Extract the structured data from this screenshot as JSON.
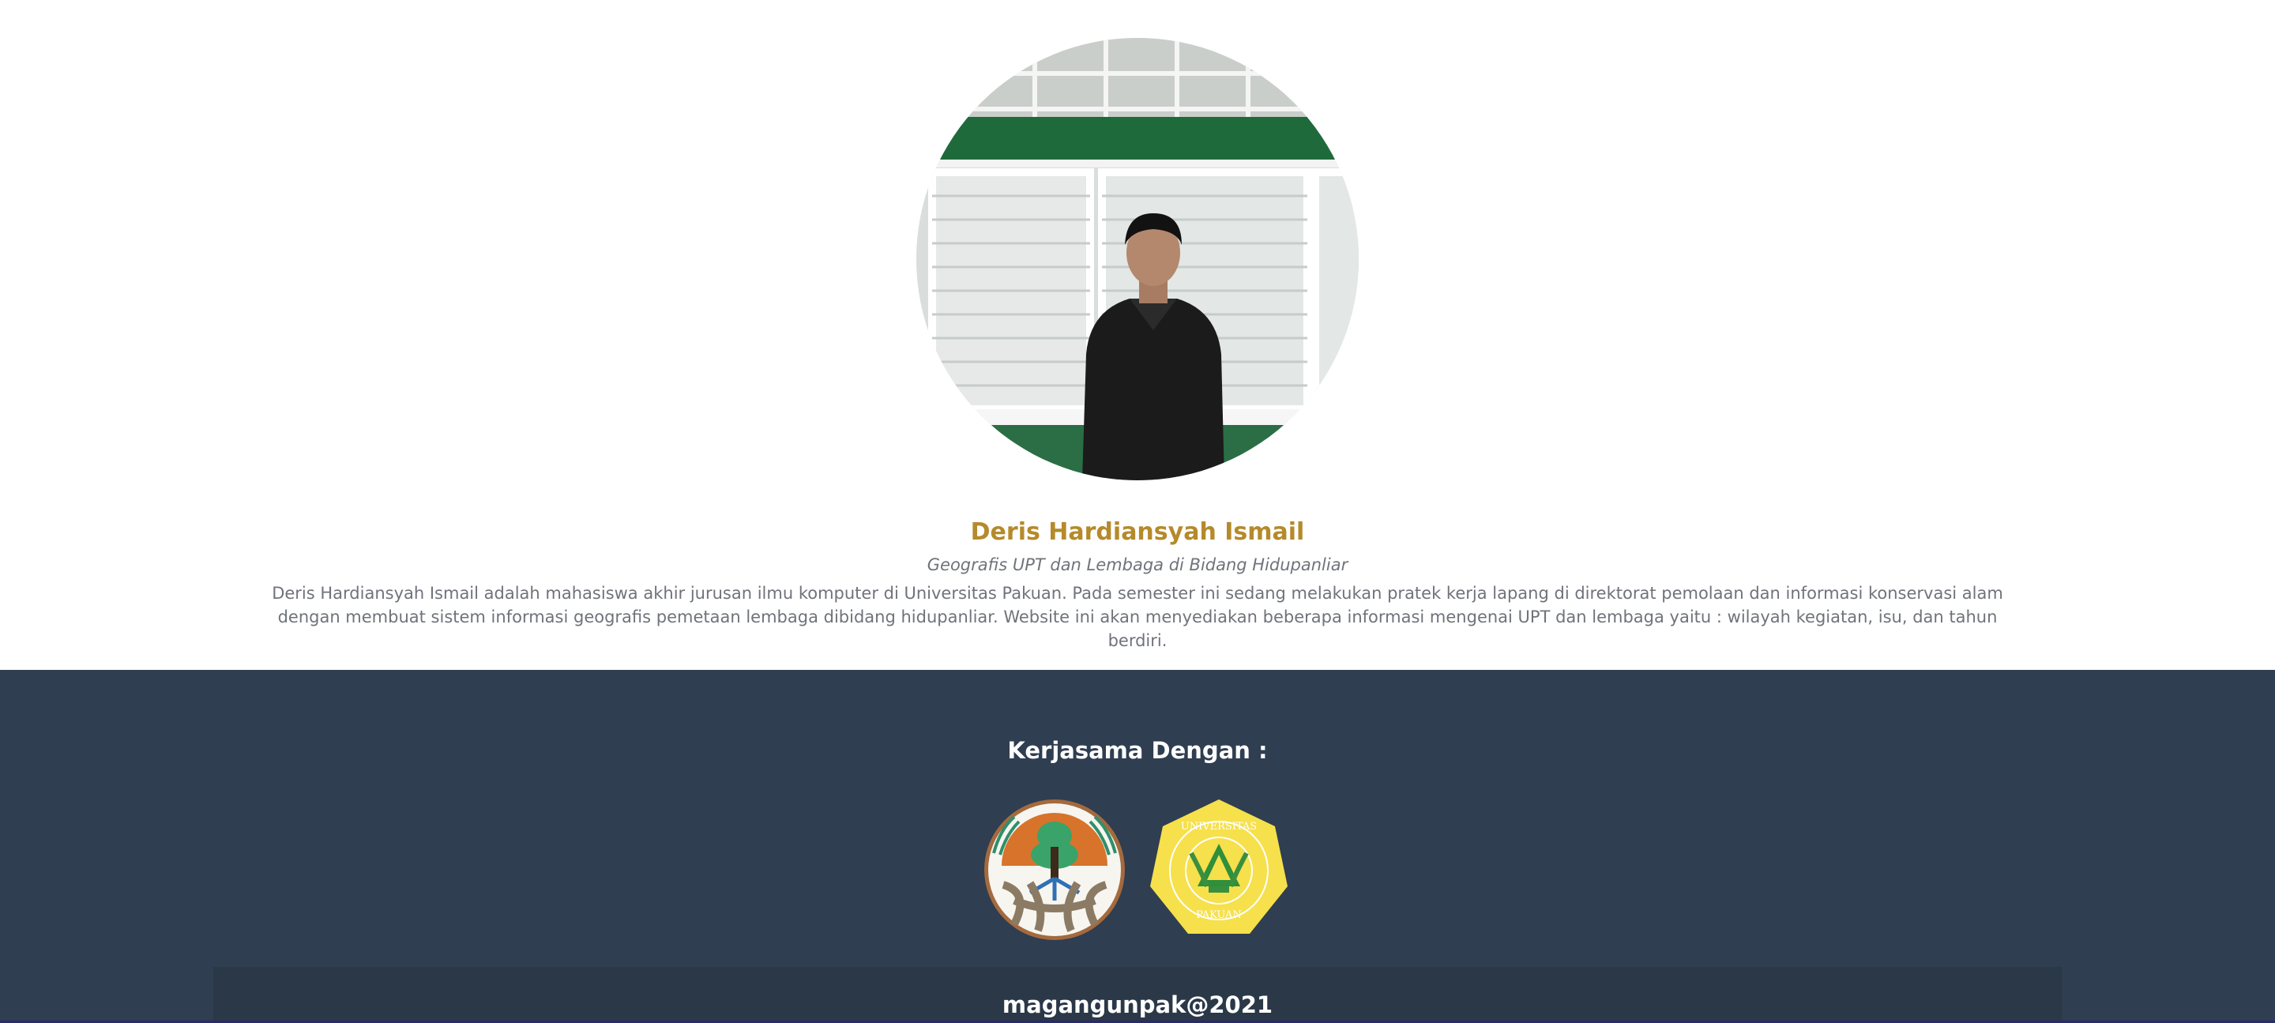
{
  "profile": {
    "photo_alt": "Deris Hardiansyah Ismail",
    "name": "Deris Hardiansyah Ismail",
    "role": "Geografis UPT dan Lembaga di Bidang Hidupanliar",
    "bio": "Deris Hardiansyah Ismail adalah mahasiswa akhir jurusan ilmu komputer di Universitas Pakuan. Pada semester ini sedang melakukan pratek kerja lapang di direktorat pemolaan dan informasi konservasi alam dengan membuat sistem informasi geografis pemetaan lembaga dibidang hidupanliar. Website ini akan menyediakan beberapa informasi mengenai UPT dan lembaga yaitu : wilayah kegiatan, isu, dan tahun berdiri."
  },
  "footer": {
    "partner_title": "Kerjasama Dengan :",
    "logos": [
      {
        "name": "klhk-logo"
      },
      {
        "name": "universitas-pakuan-logo",
        "text_top": "UNIVERSITAS",
        "text_bottom": "PAKUAN"
      }
    ],
    "copyright": "magangunpak@2021"
  },
  "colors": {
    "name_accent": "#b58a2b",
    "footer_bg": "#2f3e50",
    "body_text": "#6f737a"
  }
}
